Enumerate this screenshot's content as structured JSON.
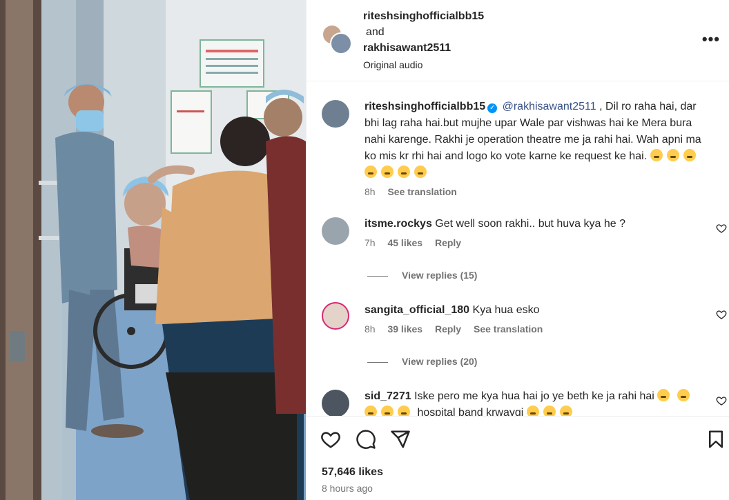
{
  "header": {
    "user1": "riteshsinghofficialbb15",
    "and_label": "and",
    "user2": "rakhisawant2511",
    "audio": "Original audio",
    "more_label": "•••"
  },
  "caption": {
    "username": "riteshsinghofficialbb15",
    "mention": "@rakhisawant2511",
    "text": ", Dil ro raha hai, dar bhi lag raha hai.but mujhe upar Wale par vishwas hai ke Mera bura nahi karenge. Rakhi je operation theatre me ja rahi hai. Wah apni ma ko mis kr rhi hai and logo ko vote karne ke request ke hai.",
    "time": "8h",
    "translate": "See translation"
  },
  "comments": [
    {
      "username": "itsme.rockys",
      "text": "Get well soon rakhi.. but huva kya he ?",
      "time": "7h",
      "likes": "45 likes",
      "reply": "Reply",
      "view_replies": "View replies (15)"
    },
    {
      "username": "sangita_official_180",
      "text": "Kya hua esko",
      "time": "8h",
      "likes": "39 likes",
      "reply": "Reply",
      "translate": "See translation",
      "view_replies": "View replies (20)"
    },
    {
      "username": "sid_7271",
      "text": "Iske pero me kya hua hai jo ye beth ke ja rahi hai",
      "text2": "hospital band krwayqi"
    }
  ],
  "footer": {
    "likes": "57,646 likes",
    "time": "8 hours ago"
  },
  "colors": {
    "link": "#385185",
    "muted": "#737373",
    "verified": "#0095f6"
  }
}
